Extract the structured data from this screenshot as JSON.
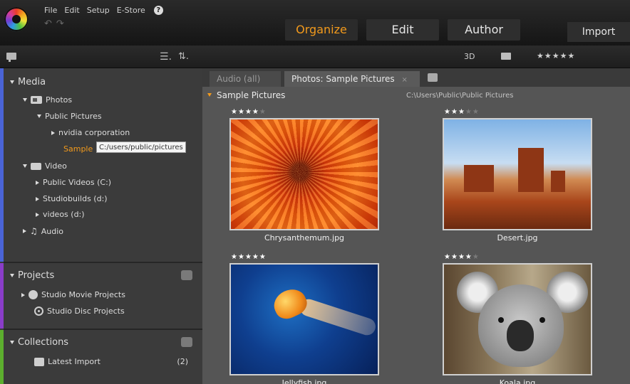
{
  "menu": {
    "items": [
      "File",
      "Edit",
      "Setup",
      "E-Store"
    ],
    "help_glyph": "?"
  },
  "undo_glyph": "↶",
  "redo_glyph": "↷",
  "modes": {
    "organize": "Organize",
    "edit": "Edit",
    "author": "Author",
    "active": "Organize"
  },
  "import_label": "Import",
  "toolbar": {
    "list_glyph": "☰.",
    "sort_glyph": "⇅.",
    "label_3d": "3D",
    "rating_filter": "★★★★★"
  },
  "sidebar": {
    "media": {
      "title": "Media",
      "photos": "Photos",
      "public_pictures": "Public Pictures",
      "nvidia": "nvidia corporation",
      "sample_selected": "Sample",
      "tooltip": "C:/users/public/pictures",
      "video": "Video",
      "public_videos": "Public Videos (C:)",
      "studiobuilds": "Studiobuilds (d:)",
      "videos": "videos (d:)",
      "audio": "Audio"
    },
    "projects": {
      "title": "Projects",
      "movie": "Studio Movie Projects",
      "disc": "Studio Disc Projects"
    },
    "collections": {
      "title": "Collections",
      "latest_import": "Latest Import",
      "latest_import_count": "(2)"
    }
  },
  "tabs": {
    "audio": "Audio (all)",
    "photos": "Photos: Sample Pictures",
    "close_glyph": "×"
  },
  "folder": {
    "name": "Sample Pictures",
    "path": "C:\\Users\\Public\\Public Pictures"
  },
  "photos": [
    {
      "caption": "Chrysanthemum.jpg",
      "rating": 4
    },
    {
      "caption": "Desert.jpg",
      "rating": 3
    },
    {
      "caption": "Jellyfish.jpg",
      "rating": 5
    },
    {
      "caption": "Koala.jpg",
      "rating": 4
    }
  ],
  "colors": {
    "accent": "#f29a1c",
    "media_stripe": "#4a64d6",
    "projects_stripe": "#8a3dc8",
    "collections_stripe": "#5cae2e"
  }
}
